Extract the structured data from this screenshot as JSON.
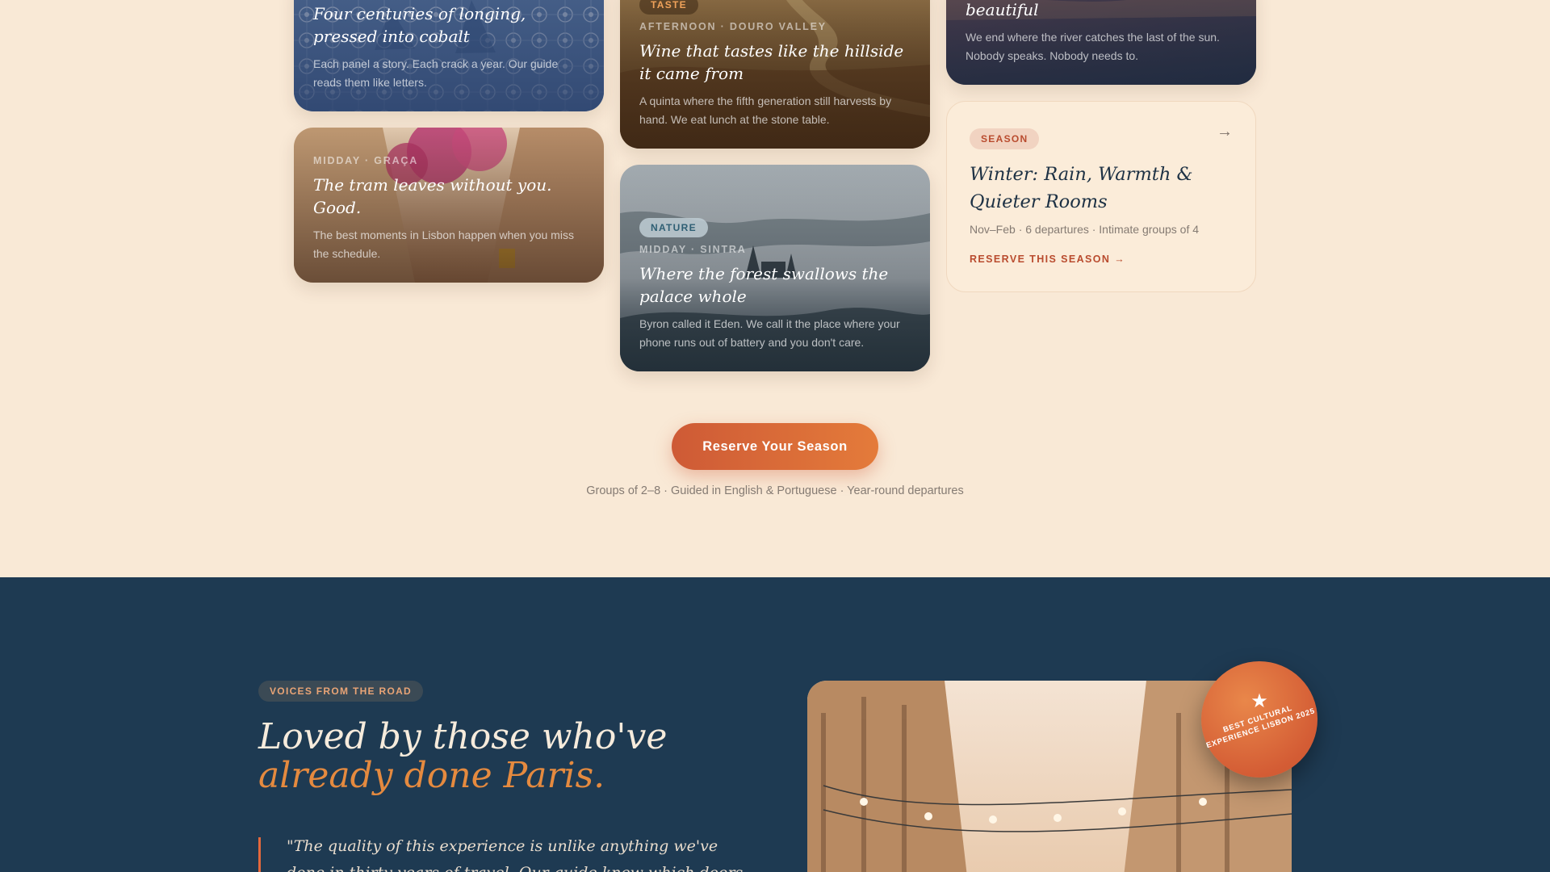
{
  "cards": [
    {
      "id": "azulejo",
      "chip": "",
      "meta": "",
      "title": "Four centuries of longing, pressed into cobalt",
      "desc": "Each panel a story. Each crack a year. Our guide reads them like letters."
    },
    {
      "id": "graca",
      "chip": "",
      "meta": "MIDDAY · GRAÇA",
      "title": "The tram leaves without you. Good.",
      "desc": "The best moments in Lisbon happen when you miss the schedule."
    },
    {
      "id": "douro",
      "chip": "TASTE",
      "meta": "AFTERNOON · DOURO VALLEY",
      "title": "Wine that tastes like the hillside it came from",
      "desc": "A quinta where the fifth generation still harvests by hand. We eat lunch at the stone table."
    },
    {
      "id": "sintra",
      "chip": "NATURE",
      "meta": "MIDDAY · SINTRA",
      "title": "Where the forest swallows the palace whole",
      "desc": "Byron called it Eden. We call it the place where your phone runs out of battery and you don't care."
    },
    {
      "id": "sunset",
      "chip": "",
      "meta": "",
      "title": "beautiful",
      "desc": "We end where the river catches the last of the sun. Nobody speaks. Nobody needs to."
    }
  ],
  "season_card": {
    "chip": "SEASON",
    "arrow": "→",
    "title": "Winter: Rain, Warmth & Quieter Rooms",
    "info": "Nov–Feb · 6 departures · Intimate groups of 4",
    "link": "RESERVE THIS SEASON  →"
  },
  "cta": {
    "label": "Reserve Your Season",
    "subtext": "Groups of 2–8 · Guided in English & Portuguese · Year-round departures"
  },
  "voices": {
    "badge": "VOICES FROM THE ROAD",
    "heading_line1": "Loved by those who've",
    "heading_line2": "already done Paris.",
    "quote": "\"The quality of this experience is unlike anything we've done in thirty years of travel. Our guide knew which doors to knock on, which tile"
  },
  "award": {
    "star": "★",
    "text": "BEST CULTURAL EXPERIENCE LISBON 2025"
  },
  "colors": {
    "page_bg": "#f9e9d6",
    "navy": "#1e3a52",
    "accent": "#d45d35",
    "accent_light": "#e58a3f"
  }
}
